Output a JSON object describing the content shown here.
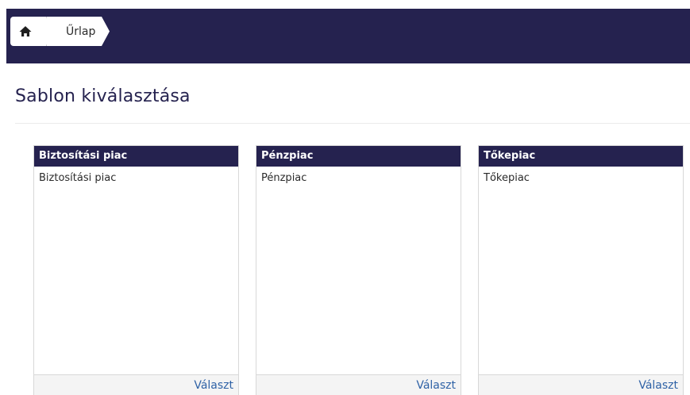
{
  "breadcrumb": {
    "home_icon": "home-icon",
    "page_label": "Űrlap"
  },
  "page": {
    "title": "Sablon kiválasztása"
  },
  "colors": {
    "header_bg": "#25224f",
    "link": "#2f62a6"
  },
  "templates": [
    {
      "header": "Biztosítási piac",
      "body": "Biztosítási piac",
      "action": "Választ"
    },
    {
      "header": "Pénzpiac",
      "body": "Pénzpiac",
      "action": "Választ"
    },
    {
      "header": "Tőkepiac",
      "body": "Tőkepiac",
      "action": "Választ"
    }
  ]
}
